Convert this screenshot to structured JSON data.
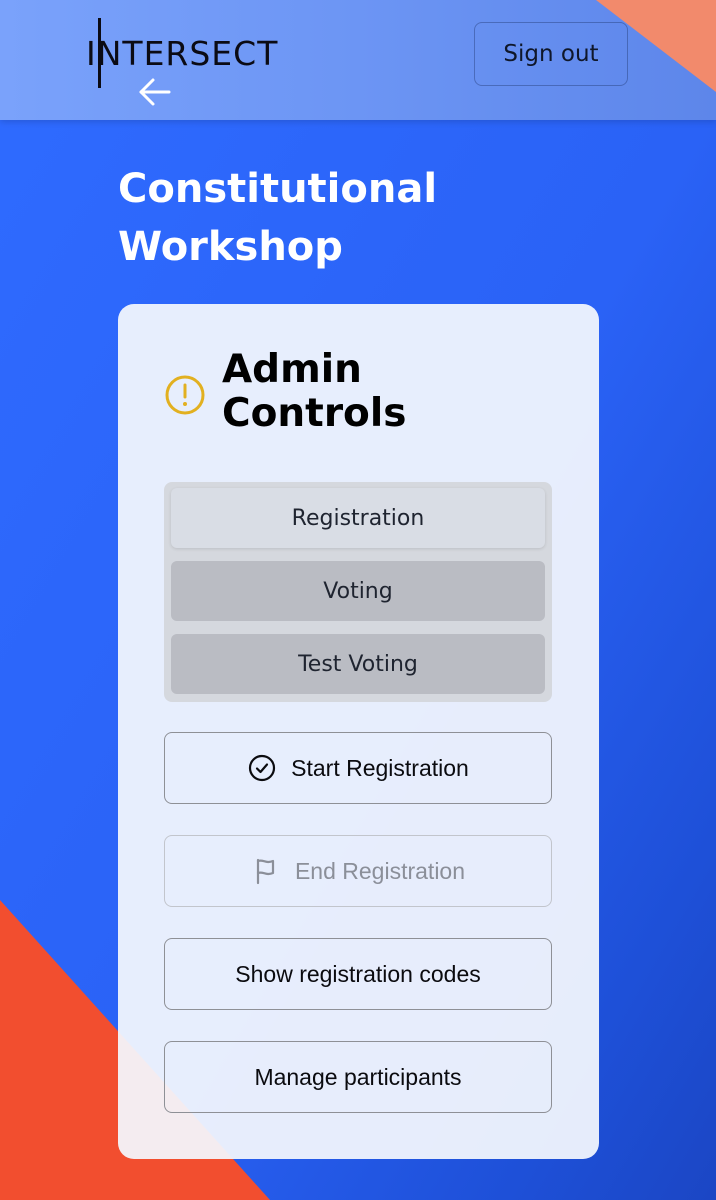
{
  "header": {
    "logo_text": "INTERSECT",
    "signout_label": "Sign out"
  },
  "page": {
    "title": "Constitutional Workshop"
  },
  "card": {
    "title": "Admin Controls",
    "tabs": [
      {
        "label": "Registration",
        "state": "active"
      },
      {
        "label": "Voting",
        "state": "inactive"
      },
      {
        "label": "Test Voting",
        "state": "inactive"
      }
    ],
    "buttons": {
      "start_registration": "Start Registration",
      "end_registration": "End Registration",
      "show_codes": "Show registration codes",
      "manage_participants": "Manage participants"
    }
  },
  "icons": {
    "back": "arrow-left-icon",
    "alert": "alert-circle-icon",
    "start": "check-circle-icon",
    "end": "flag-icon"
  },
  "colors": {
    "background": "#2f6bff",
    "accent_orange": "#f24e2f",
    "alert_yellow": "#e2b020"
  }
}
